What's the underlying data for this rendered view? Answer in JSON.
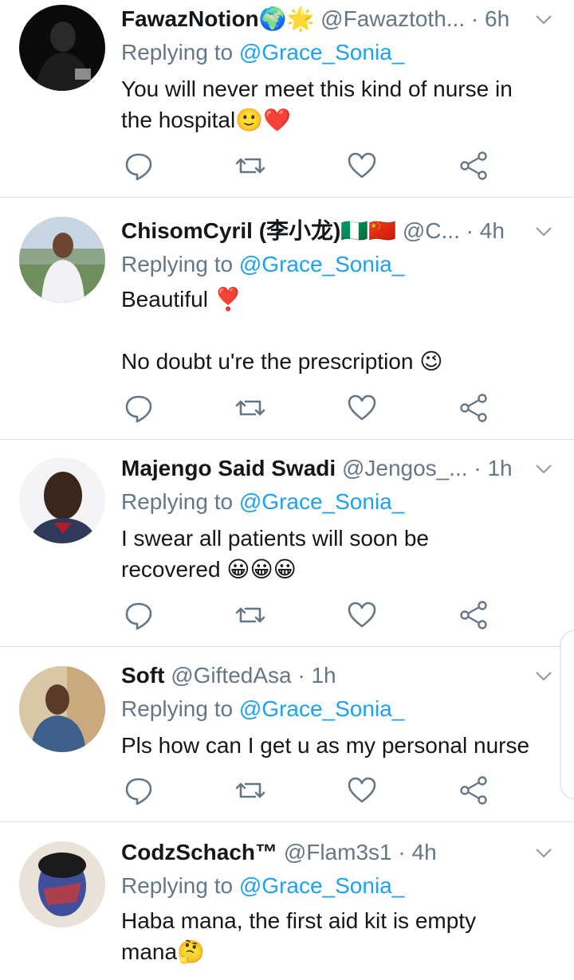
{
  "tweets": [
    {
      "name": "FawazNotion🌍🌟",
      "handle": "@Fawaztoth...",
      "time": " · 6h",
      "replying_prefix": "Replying to ",
      "replying_to": "@Grace_Sonia_",
      "text_lines": [
        "You will never meet this kind of nurse in",
        "the hospital🙂❤️"
      ],
      "avatar_desc": "man in black hoodie on black background"
    },
    {
      "name": "ChisomCyril (李小龙)🇳🇬🇨🇳",
      "handle": "@C...",
      "time": " · 4h",
      "replying_prefix": "Replying to ",
      "replying_to": "@Grace_Sonia_",
      "text_lines": [
        "Beautiful ❣️",
        "",
        "No doubt u're the prescription 😉"
      ],
      "avatar_desc": "man in white shirt outdoors"
    },
    {
      "name": "Majengo Said Swadi",
      "handle": "@Jengos_...",
      "time": " · 1h",
      "replying_prefix": "Replying to ",
      "replying_to": "@Grace_Sonia_",
      "text_lines": [
        "I swear all patients will soon be",
        "recovered 😀😀😀"
      ],
      "avatar_desc": "smiling man"
    },
    {
      "name": "Soft",
      "handle": "@GiftedAsa",
      "time": " · 1h",
      "replying_prefix": "Replying to ",
      "replying_to": "@Grace_Sonia_",
      "text_lines": [
        "Pls how can I get u as my personal nurse"
      ],
      "avatar_desc": "man in denim jacket"
    },
    {
      "name": "CodzSchach™",
      "handle": "@Flam3s1",
      "time": " · 4h",
      "replying_prefix": "Replying to ",
      "replying_to": "@Grace_Sonia_",
      "text_lines": [
        "Haba mana, the first aid kit is empty",
        "mana🤔"
      ],
      "avatar_desc": "painted portrait avatar"
    }
  ],
  "icons": {
    "reply": "reply-icon",
    "retweet": "retweet-icon",
    "like": "heart-icon",
    "share": "share-icon",
    "more": "chevron-down-icon"
  },
  "colors": {
    "name": "#14171a",
    "meta": "#657786",
    "mention": "#1da1f2",
    "divider": "#dcdfe2"
  }
}
